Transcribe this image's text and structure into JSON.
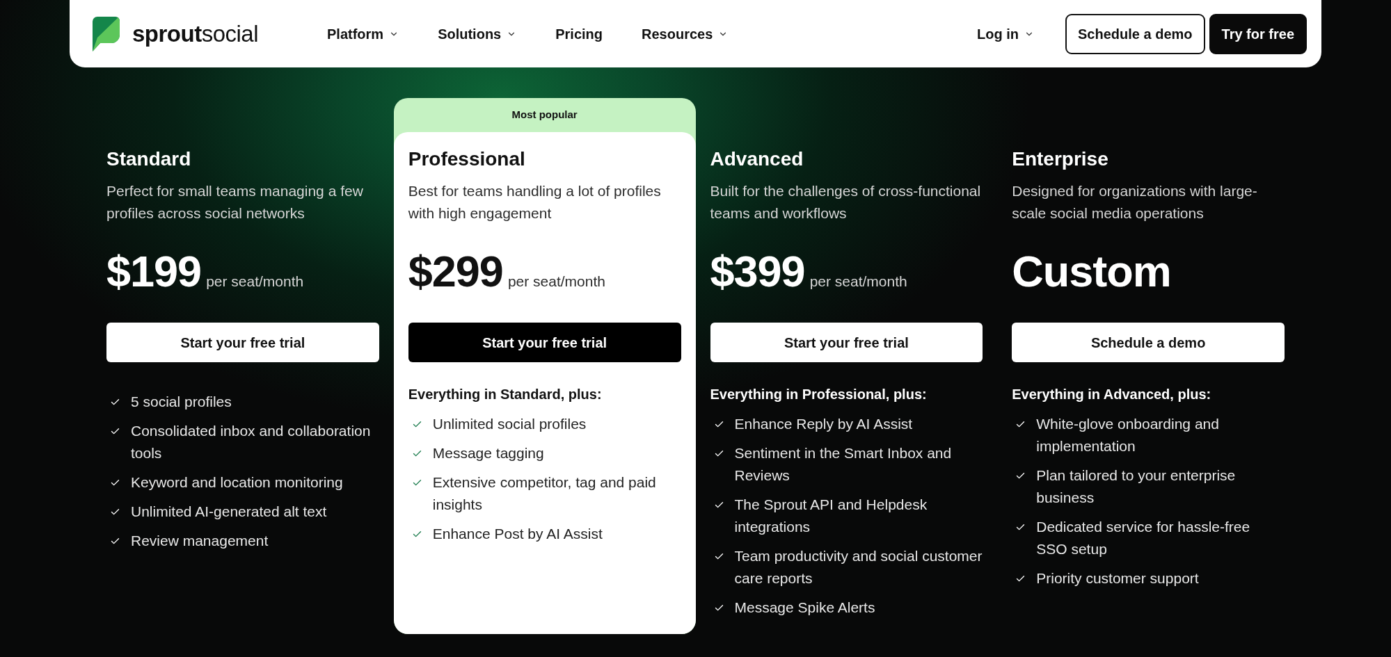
{
  "nav": {
    "logo": "**sprout**social",
    "items": [
      {
        "label": "Platform",
        "has_menu": true
      },
      {
        "label": "Solutions",
        "has_menu": true
      },
      {
        "label": "Pricing",
        "has_menu": false
      },
      {
        "label": "Resources",
        "has_menu": true
      }
    ],
    "login": {
      "label": "Log in",
      "has_menu": true
    },
    "buttons": [
      {
        "label": "Schedule a demo",
        "kind": "outline"
      },
      {
        "label": "Try for free",
        "kind": "solid"
      }
    ]
  },
  "plans": [
    {
      "name": "Standard",
      "featured": false,
      "description": "Perfect for small teams managing a few profiles across social networks",
      "price": "$199",
      "period": "per seat/month",
      "cta": "Start your free trial",
      "features": [
        "5 social profiles",
        "Consolidated inbox and collaboration tools",
        "Keyword and location monitoring",
        "Unlimited AI-generated alt text",
        "Review management"
      ]
    },
    {
      "name": "Professional",
      "featured": true,
      "badge": "Most popular",
      "description": "Best for teams handling a lot of profiles with high engagement",
      "price": "$299",
      "period": "per seat/month",
      "cta": "Start your free trial",
      "features_heading": "Everything in Standard, plus:",
      "features": [
        "Unlimited social profiles",
        "Message tagging",
        "Extensive competitor, tag and paid insights",
        "Enhance Post by AI Assist"
      ]
    },
    {
      "name": "Advanced",
      "featured": false,
      "description": "Built for the challenges of cross-functional teams and workflows",
      "price": "$399",
      "period": "per seat/month",
      "cta": "Start your free trial",
      "features_heading": "Everything in Professional, plus:",
      "features": [
        "Enhance Reply by AI Assist",
        "Sentiment in the Smart Inbox and Reviews",
        "The Sprout API and Helpdesk integrations",
        "Team productivity and social customer care reports",
        "Message Spike Alerts"
      ]
    },
    {
      "name": "Enterprise",
      "featured": false,
      "description": "Designed for organizations with large-scale social media operations",
      "price": "Custom",
      "cta": "Schedule a demo",
      "features_heading": "Everything in Advanced, plus:",
      "features": [
        "White-glove onboarding and implementation",
        "Plan tailored to your enterprise business",
        "Dedicated service for hassle-free SSO setup",
        "Priority customer support"
      ]
    }
  ]
}
